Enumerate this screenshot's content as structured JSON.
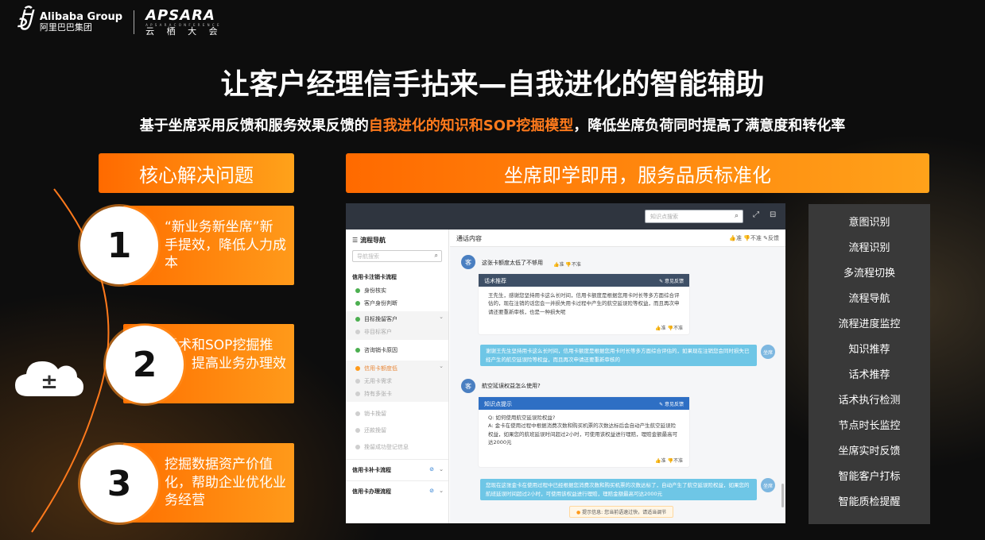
{
  "logo": {
    "alibaba_en": "Alibaba Group",
    "alibaba_cn": "阿里巴巴集团",
    "apsara_en": "APSARA",
    "apsara_sub": "A P S A R A   C O N F E R E N C E",
    "apsara_cn": "云 栖 大 会"
  },
  "title": "让客户经理信手拈来—自我进化的智能辅助",
  "subtitle": {
    "before": "基于坐席采用反馈和服务效果反馈的",
    "highlight": "自我进化的知识和SOP挖掘模型",
    "after": "，降低坐席负荷同时提高了满意度和转化率"
  },
  "left_header": "核心解决问题",
  "right_header": "坐席即学即用，服务品质标准化",
  "problems": [
    {
      "num": "1",
      "text": "“新业务新坐席”新手提效，降低人力成本"
    },
    {
      "num": "2",
      "text": "话术和SOP挖掘推荐，提高业务办理效果"
    },
    {
      "num": "3",
      "text": "挖掘数据资产价值化，帮助企业优化业务经营"
    }
  ],
  "cloud_icon_glyph": "±",
  "app": {
    "search_placeholder": "知识点搜索",
    "nav": {
      "title": "流程导航",
      "search_placeholder": "导航搜索",
      "section": "信用卡注销卡流程",
      "items": [
        {
          "label": "身份核实",
          "state": "done"
        },
        {
          "label": "客户身份判断",
          "state": "done"
        }
      ],
      "group1": {
        "label": "目标挽留客户",
        "sub": "非目标客户"
      },
      "item3": "咨询销卡原因",
      "group2": {
        "label": "信用卡额度低",
        "subs": [
          "无用卡需求",
          "持有多张卡"
        ]
      },
      "muted_items": [
        "销卡挽留",
        "还款挽留",
        "挽留成功登记信息"
      ],
      "footer1": "信用卡补卡流程",
      "footer2": "信用卡办理流程"
    },
    "convo": {
      "header": "通话内容",
      "header_feedback": "👍准  👎不准  ✎反馈",
      "msg1": "这张卡额度太低了不够用",
      "msg_fb": "👍准  👎不准",
      "card1": {
        "title": "话术推荐",
        "action": "✎ 意见反馈",
        "body": "王先生，感谢您坚持用卡这么长时间，信用卡额度是根据您用卡时长等多方面综合评估的，现在注销的话您会一并损失用卡过程中产生的航空延误险等权益，而且再次申请还要重新审核，也是一种损失呢",
        "foot": "👍准  👎不准"
      },
      "agent1": "谢谢王先生坚持用卡这么长时间，信用卡额度是根据您用卡时长等多方面综合评估的，如果现在注销您会同时损失已经产生的航空延误险等权益，而且再次申请还要重新审核的",
      "msg2": "航空延误权益怎么使用?",
      "card2": {
        "title": "知识点提示",
        "action": "✎ 意见反馈",
        "q": "Q: 如何使用航空延误险权益?",
        "a": "A: 金卡在使用过程中根据消费次数和购买机票的次数达标后会自动产生航空延误险权益，如果您的航班延误时间超过2小时，可使用该权益进行理赔，理赔金额最高可达2000元",
        "foot": "👍准  👎不准"
      },
      "agent2": "您现在这张金卡在使用过程中已经根据您消费次数和购买机票的次数达标了，自动产生了航空延误险权益，如果您的航班延误时间超过2小时，可使用该权益进行理赔，理赔金额最高可达2000元",
      "customer_label": "客",
      "agent_label": "坐席",
      "tip": "提示信息: 您当前语速过快，请适当调节"
    }
  },
  "features": [
    "意图识别",
    "流程识别",
    "多流程切换",
    "流程导航",
    "流程进度监控",
    "知识推荐",
    "话术推荐",
    "话术执行检测",
    "节点时长监控",
    "坐席实时反馈",
    "智能客户打标",
    "智能质检提醒"
  ],
  "colors": {
    "accent": "#ff7a1c",
    "orange_start": "#ff6a00",
    "orange_end": "#ffa21a",
    "panel": "#393939"
  }
}
